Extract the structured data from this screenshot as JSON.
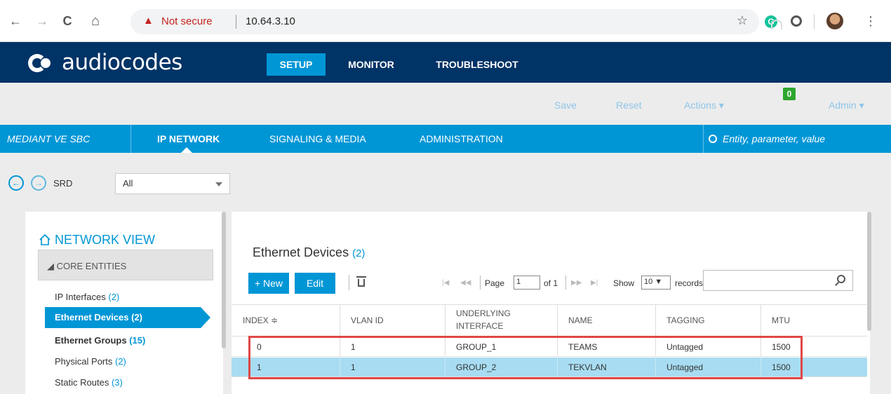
{
  "browser": {
    "back": "←",
    "forward": "→",
    "reload": "C",
    "home": "⌂",
    "security_icon": "warning-triangle-icon",
    "security_text": "Not secure",
    "url": "10.64.3.10",
    "star": "☆",
    "grammarly": "G",
    "menu": "⋮"
  },
  "app": {
    "logo_text": "audiocodes",
    "top_tabs": [
      {
        "label": "SETUP",
        "active": true
      },
      {
        "label": "MONITOR",
        "active": false
      },
      {
        "label": "TROUBLESHOOT",
        "active": false
      }
    ]
  },
  "toolbar": {
    "save": "Save",
    "reset": "Reset",
    "actions": "Actions ▾",
    "notifications_count": "0",
    "admin": "Admin ▾"
  },
  "nav": {
    "device": "MEDIANT VE SBC",
    "items": [
      "IP NETWORK",
      "SIGNALING & MEDIA",
      "ADMINISTRATION"
    ],
    "active_item": "IP NETWORK",
    "search_placeholder": "Entity, parameter, value"
  },
  "srd": {
    "label": "SRD",
    "value": "All"
  },
  "sidebar": {
    "title": "NETWORK VIEW",
    "section": "◢ CORE ENTITIES",
    "items": [
      {
        "label": "IP Interfaces",
        "count": "(2)"
      },
      {
        "label": "Ethernet Devices (2)",
        "count": ""
      },
      {
        "label": "Ethernet Groups",
        "count": "(15)"
      },
      {
        "label": "Physical Ports",
        "count": "(2)"
      },
      {
        "label": "Static Routes",
        "count": "(3)"
      }
    ],
    "active_index": 1
  },
  "content": {
    "title": "Ethernet Devices",
    "title_count": "(2)",
    "new_button": "+ New",
    "edit_button": "Edit",
    "pager": {
      "page_label": "Page",
      "page_value": "1",
      "of_label": "of 1",
      "show_label": "Show",
      "rows_value": "10 ▼",
      "records_label": "records per page"
    },
    "columns": [
      "INDEX ≑",
      "VLAN ID",
      "UNDERLYING",
      "INTERFACE",
      "NAME",
      "TAGGING",
      "MTU"
    ],
    "rows": [
      {
        "index": "0",
        "vlan": "1",
        "interface": "GROUP_1",
        "name": "TEAMS",
        "tagging": "Untagged",
        "mtu": "1500",
        "selected": false
      },
      {
        "index": "1",
        "vlan": "1",
        "interface": "GROUP_2",
        "name": "TEKVLAN",
        "tagging": "Untagged",
        "mtu": "1500",
        "selected": true
      }
    ]
  },
  "colors": {
    "header": "#003366",
    "accent": "#0096d6",
    "selected_row": "#a8dcf2",
    "highlight": "#e04747",
    "badge": "#2fa52f"
  }
}
